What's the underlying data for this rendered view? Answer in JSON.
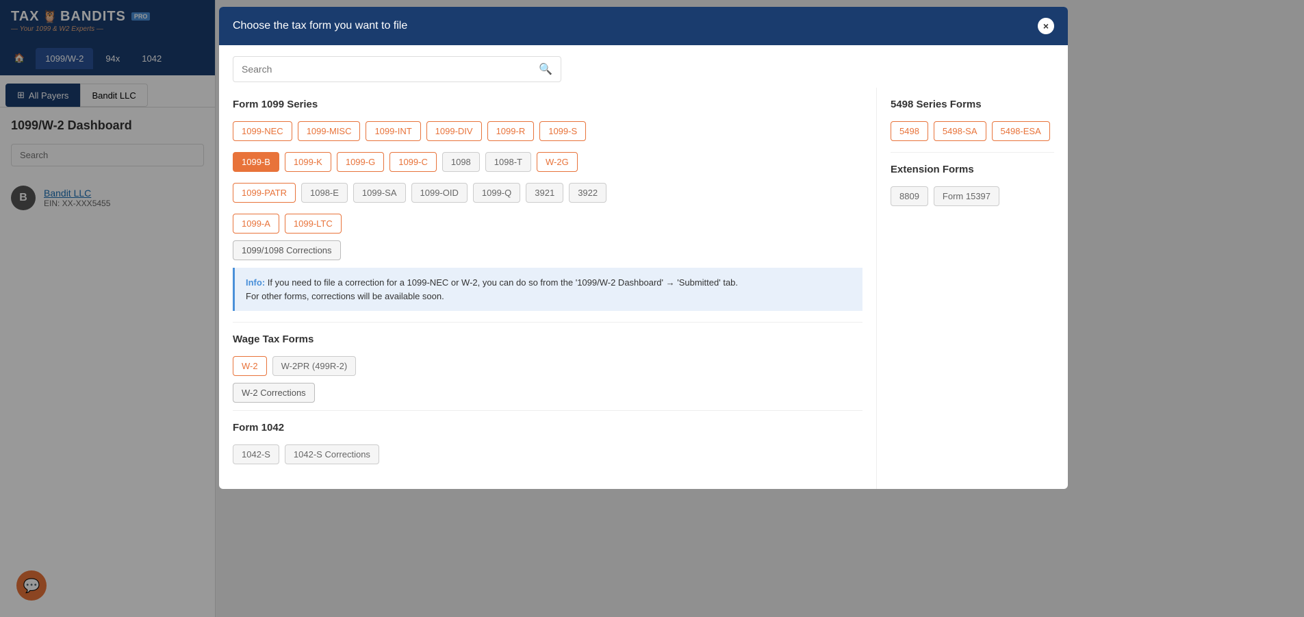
{
  "sidebar": {
    "logo": {
      "text": "TAX BANDITS",
      "pro_badge": "PRO",
      "subtitle": "— Your 1099 & W2 Experts —"
    },
    "nav_tabs": [
      {
        "id": "home",
        "label": "🏠",
        "active": false
      },
      {
        "id": "1099w2",
        "label": "1099/W-2",
        "active": true
      },
      {
        "id": "94x",
        "label": "94x",
        "active": false
      },
      {
        "id": "1042",
        "label": "1042",
        "active": false
      }
    ],
    "payer_tabs": [
      {
        "id": "all-payers",
        "label": "All Payers",
        "icon": "grid",
        "active": true
      },
      {
        "id": "bandit-llc",
        "label": "Bandit LLC",
        "active": false
      }
    ],
    "dashboard_title": "1099/W-2 Dashboard",
    "search_placeholder": "Search",
    "payers": [
      {
        "id": "bandit-llc",
        "initial": "B",
        "name": "Bandit LLC",
        "ein": "EIN: XX-XXX5455"
      }
    ]
  },
  "chat_bubble": {
    "icon": "💬"
  },
  "modal": {
    "title": "Choose the tax form you want to file",
    "close_icon": "×",
    "search_placeholder": "Search",
    "sections": {
      "form_1099": {
        "title": "Form 1099 Series",
        "tags": [
          {
            "label": "1099-NEC",
            "style": "outline",
            "active": false
          },
          {
            "label": "1099-MISC",
            "style": "outline",
            "active": false
          },
          {
            "label": "1099-INT",
            "style": "outline",
            "active": false
          },
          {
            "label": "1099-DIV",
            "style": "outline",
            "active": false
          },
          {
            "label": "1099-R",
            "style": "outline",
            "active": false
          },
          {
            "label": "1099-S",
            "style": "outline",
            "active": false
          },
          {
            "label": "1099-B",
            "style": "active",
            "active": true
          },
          {
            "label": "1099-K",
            "style": "outline",
            "active": false
          },
          {
            "label": "1099-G",
            "style": "outline",
            "active": false
          },
          {
            "label": "1099-C",
            "style": "outline",
            "active": false
          },
          {
            "label": "1098",
            "style": "disabled",
            "active": false
          },
          {
            "label": "1098-T",
            "style": "disabled",
            "active": false
          },
          {
            "label": "W-2G",
            "style": "outline",
            "active": false
          },
          {
            "label": "1099-PATR",
            "style": "outline",
            "active": false
          },
          {
            "label": "1098-E",
            "style": "disabled",
            "active": false
          },
          {
            "label": "1099-SA",
            "style": "disabled",
            "active": false
          },
          {
            "label": "1099-OID",
            "style": "disabled",
            "active": false
          },
          {
            "label": "1099-Q",
            "style": "disabled",
            "active": false
          },
          {
            "label": "3921",
            "style": "disabled",
            "active": false
          },
          {
            "label": "3922",
            "style": "disabled",
            "active": false
          },
          {
            "label": "1099-A",
            "style": "outline",
            "active": false
          },
          {
            "label": "1099-LTC",
            "style": "outline",
            "active": false
          }
        ],
        "corrections_label": "1099/1098 Corrections",
        "info_text_label": "Info:",
        "info_text": " If you need to file a correction for a 1099-NEC or W-2, you can do so from the '1099/W-2 Dashboard' → 'Submitted' tab.\nFor other forms, corrections will be available soon."
      },
      "wage_tax": {
        "title": "Wage Tax Forms",
        "tags": [
          {
            "label": "W-2",
            "style": "w2",
            "active": false
          },
          {
            "label": "W-2PR (499R-2)",
            "style": "disabled",
            "active": false
          }
        ],
        "corrections_label": "W-2 Corrections"
      },
      "form_1042": {
        "title": "Form 1042",
        "tags": [
          {
            "label": "1042-S",
            "style": "disabled",
            "active": false
          },
          {
            "label": "1042-S Corrections",
            "style": "disabled",
            "active": false
          }
        ]
      },
      "series_5498": {
        "title": "5498 Series Forms",
        "tags": [
          {
            "label": "5498",
            "style": "outline",
            "active": false
          },
          {
            "label": "5498-SA",
            "style": "outline",
            "active": false
          },
          {
            "label": "5498-ESA",
            "style": "outline",
            "active": false
          }
        ]
      },
      "extension": {
        "title": "Extension Forms",
        "tags": [
          {
            "label": "8809",
            "style": "disabled",
            "active": false
          },
          {
            "label": "Form 15397",
            "style": "disabled",
            "active": false
          }
        ]
      }
    }
  }
}
